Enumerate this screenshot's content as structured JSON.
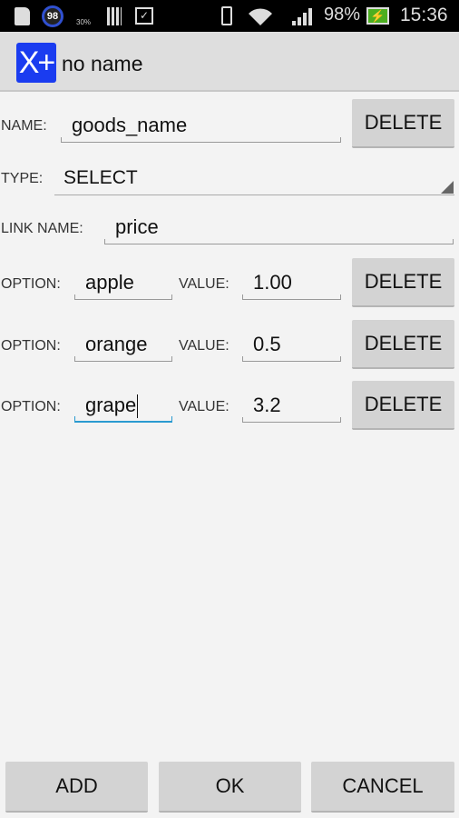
{
  "status_bar": {
    "battery": "98%",
    "time": "15:36",
    "notification_badge": "98",
    "weather_label": "30%",
    "icons": [
      "sd-card-icon",
      "badge-icon",
      "weather-icon",
      "barcode-icon",
      "clipboard-check-icon",
      "vibrate-icon",
      "wifi-icon",
      "signal-icon",
      "battery-charging-icon"
    ]
  },
  "action_bar": {
    "title": "no name",
    "app_icon": "x-plus-icon",
    "icon_color": "#1a3cf0"
  },
  "form": {
    "name_label": "NAME:",
    "name_value": "goods_name",
    "delete_label": "DELETE",
    "type_label": "TYPE:",
    "type_value": "SELECT",
    "link_label": "LINK NAME:",
    "link_value": "price",
    "option_label": "OPTION:",
    "value_label": "VALUE:",
    "options": [
      {
        "option": "apple",
        "value": "1.00"
      },
      {
        "option": "orange",
        "value": "0.5"
      },
      {
        "option": "grape",
        "value": "3.2"
      }
    ]
  },
  "footer": {
    "add": "ADD",
    "ok": "OK",
    "cancel": "CANCEL"
  },
  "colors": {
    "focus": "#2a9ad0",
    "battery": "#4caf20"
  }
}
